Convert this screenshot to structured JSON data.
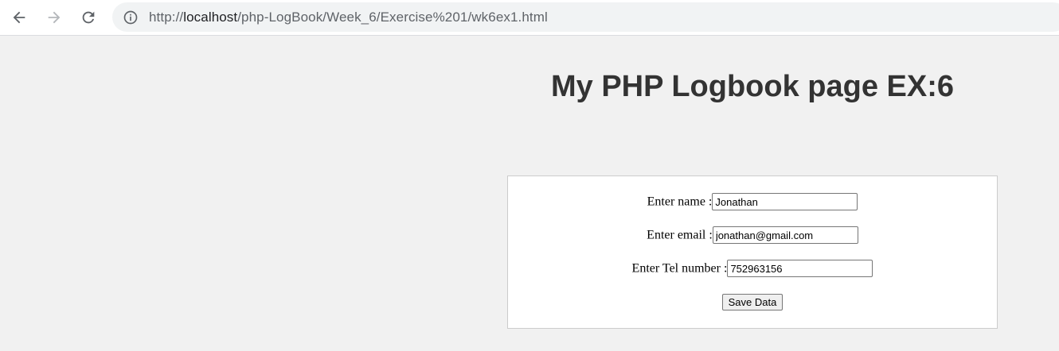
{
  "browser": {
    "url_prefix": "http://",
    "url_host": "localhost",
    "url_path": "/php-LogBook/Week_6/Exercise%201/wk6ex1.html",
    "icons": {
      "back": "back-arrow-icon",
      "forward": "forward-arrow-icon",
      "reload": "reload-icon",
      "info": "info-icon"
    }
  },
  "page": {
    "title": "My PHP Logbook page EX:6"
  },
  "form": {
    "name_label": "Enter name :",
    "name_value": "Jonathan",
    "email_label": "Enter email :",
    "email_value": "jonathan@gmail.com",
    "tel_label": "Enter Tel number :",
    "tel_value": "752963156",
    "save_label": "Save Data"
  }
}
